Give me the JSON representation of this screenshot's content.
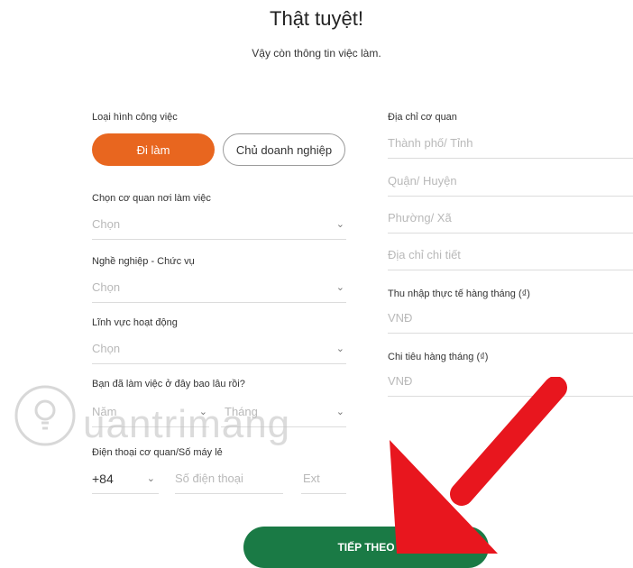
{
  "header": {
    "title": "Thật tuyệt!",
    "subtitle": "Vậy còn thông tin việc làm."
  },
  "left": {
    "job_type": {
      "label": "Loại hình công việc",
      "options": [
        "Đi làm",
        "Chủ doanh nghiệp"
      ],
      "selected": "Đi làm"
    },
    "employer": {
      "label": "Chọn cơ quan nơi làm việc",
      "placeholder": "Chọn"
    },
    "occupation": {
      "label": "Nghề nghiệp - Chức vụ",
      "placeholder": "Chọn"
    },
    "industry": {
      "label": "Lĩnh vực hoạt động",
      "placeholder": "Chọn"
    },
    "tenure": {
      "label": "Bạn đã làm việc ở đây bao lâu rồi?",
      "year_placeholder": "Năm",
      "month_placeholder": "Tháng"
    },
    "office_phone": {
      "label": "Điện thoại cơ quan/Số máy lẻ",
      "country_code": "+84",
      "phone_placeholder": "Số điện thoại",
      "ext_placeholder": "Ext"
    }
  },
  "right": {
    "office_address": {
      "label": "Địa chỉ cơ quan",
      "city_placeholder": "Thành phố/ Tỉnh",
      "district_placeholder": "Quận/ Huyện",
      "ward_placeholder": "Phường/ Xã",
      "detail_placeholder": "Địa chỉ chi tiết"
    },
    "monthly_income": {
      "label": "Thu nhập thực tế hàng tháng (₫)",
      "placeholder": "VNĐ"
    },
    "monthly_spending": {
      "label": "Chi tiêu hàng tháng (₫)",
      "placeholder": "VNĐ"
    }
  },
  "footer": {
    "next_label": "TIẾP THEO"
  },
  "overlay": {
    "watermark_text": "uantrimang",
    "arrow_color": "#e8161e"
  },
  "colors": {
    "primary": "#e8661f",
    "next": "#1a7a45"
  },
  "icons": {
    "chevron": "chevron-down-icon"
  }
}
